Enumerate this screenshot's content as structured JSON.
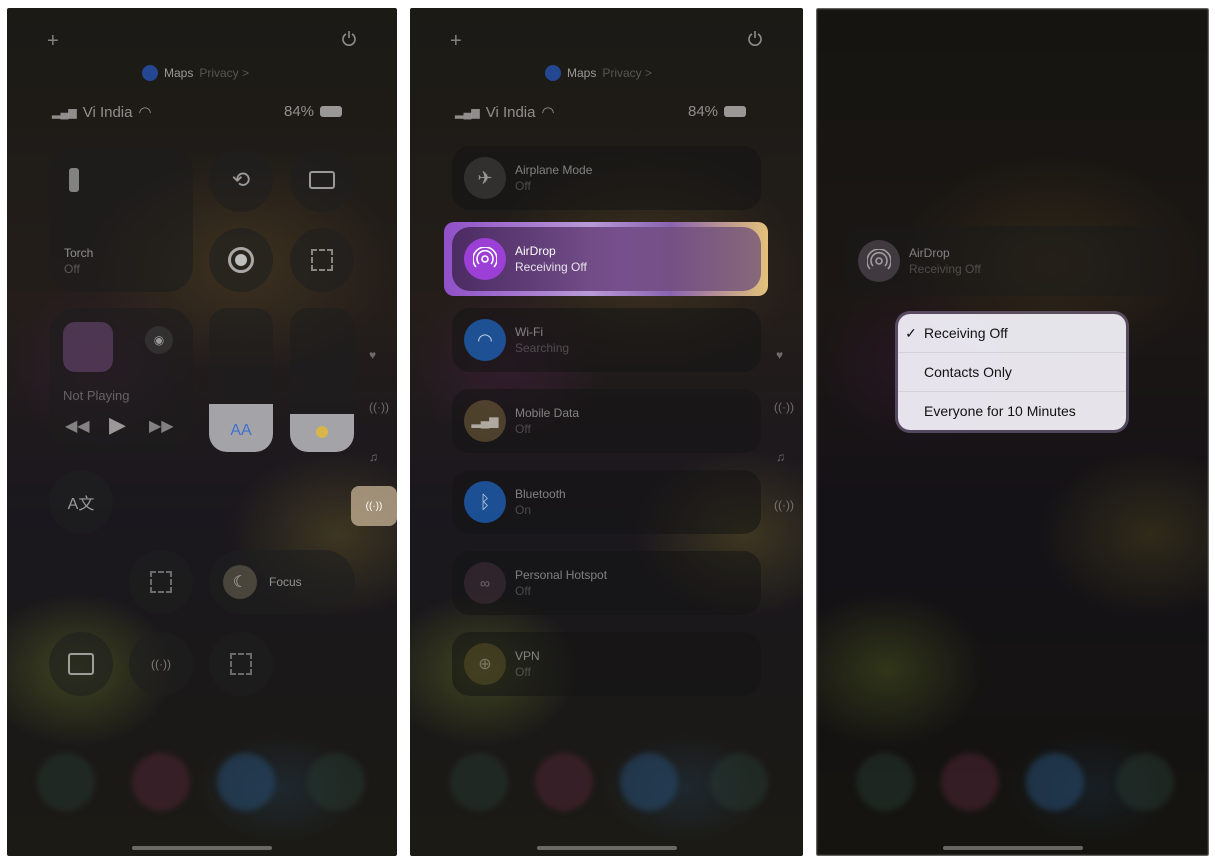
{
  "panel1": {
    "top": {
      "plus_icon": "plus",
      "location_app": "Maps",
      "location_privacy": "Privacy >",
      "power_icon": "power"
    },
    "status": {
      "carrier": "Vi India",
      "battery": "84%"
    },
    "torch": {
      "label": "Torch",
      "state": "Off"
    },
    "now_playing": {
      "label": "Not Playing"
    },
    "text_size_label": "AA",
    "focus_label": "Focus"
  },
  "panel2": {
    "top": {
      "location_app": "Maps",
      "location_privacy": "Privacy >"
    },
    "status": {
      "carrier": "Vi India",
      "battery": "84%"
    },
    "rows": [
      {
        "title": "Airplane Mode",
        "subtitle": "Off"
      },
      {
        "title": "AirDrop",
        "subtitle": "Receiving Off"
      },
      {
        "title": "Wi-Fi",
        "subtitle": "Searching"
      },
      {
        "title": "Mobile Data",
        "subtitle": "Off"
      },
      {
        "title": "Bluetooth",
        "subtitle": "On"
      },
      {
        "title": "Personal Hotspot",
        "subtitle": "Off"
      },
      {
        "title": "VPN",
        "subtitle": "Off"
      }
    ]
  },
  "panel3": {
    "airdrop": {
      "title": "AirDrop",
      "subtitle": "Receiving Off"
    },
    "menu": {
      "options": [
        "Receiving Off",
        "Contacts Only",
        "Everyone for 10 Minutes"
      ],
      "checkmark": "✓",
      "selected_index": 0
    }
  },
  "colors": {
    "airdrop_accent": "#9b3fd6",
    "wifi_blue": "#1f6fd6",
    "bluetooth_blue": "#1f6fd6",
    "highlight_yellow": "#e8c46a"
  }
}
